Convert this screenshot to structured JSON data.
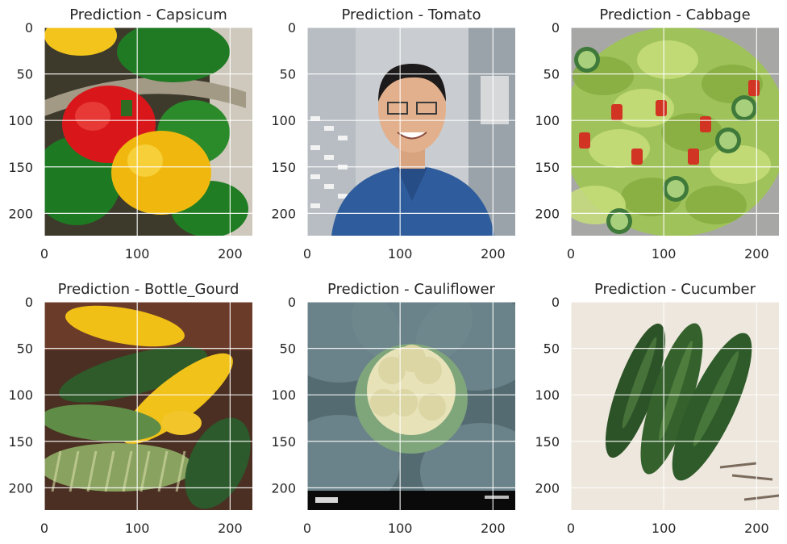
{
  "figure": {
    "panels": [
      {
        "title": "Prediction - Capsicum",
        "image": "bell-peppers-photo"
      },
      {
        "title": "Prediction - Tomato",
        "image": "man-portrait-photo"
      },
      {
        "title": "Prediction - Cabbage",
        "image": "salad-bowl-photo"
      },
      {
        "title": "Prediction - Bottle_Gourd",
        "image": "squash-basket-photo"
      },
      {
        "title": "Prediction - Cauliflower",
        "image": "cauliflower-photo"
      },
      {
        "title": "Prediction - Cucumber",
        "image": "zucchini-photo"
      }
    ],
    "xticks": [
      "0",
      "100",
      "200"
    ],
    "yticks": [
      "0",
      "50",
      "100",
      "150",
      "200"
    ]
  },
  "chart_data": {
    "type": "image-grid",
    "rows": 2,
    "cols": 3,
    "xlim": [
      0,
      224
    ],
    "ylim": [
      224,
      0
    ],
    "xtick_values": [
      0,
      100,
      200
    ],
    "ytick_values": [
      0,
      50,
      100,
      150,
      200
    ],
    "grid": true,
    "colors": {
      "grid": "#ffffff",
      "text": "#262626",
      "background": "#ffffff"
    }
  }
}
